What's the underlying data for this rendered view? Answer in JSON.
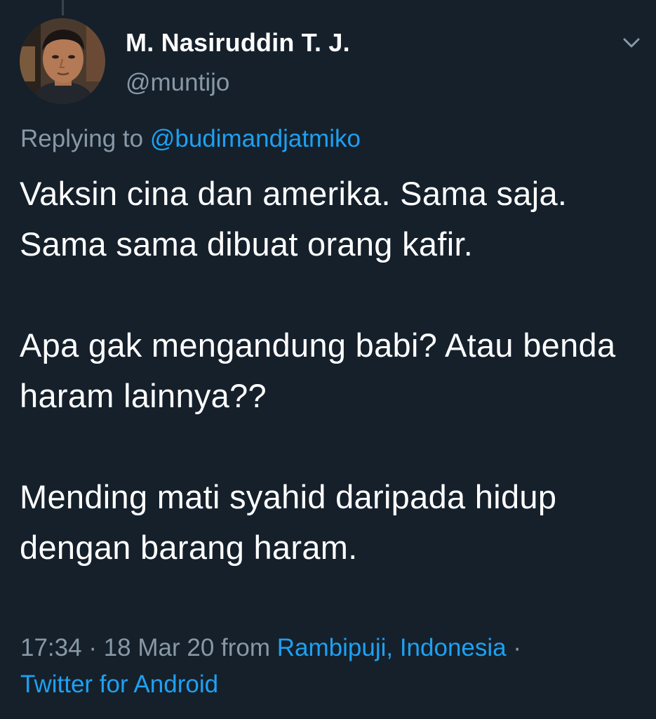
{
  "tweet": {
    "display_name": "M. Nasiruddin T. J.",
    "username": "@muntijo",
    "reply_prefix": "Replying to ",
    "reply_to": "@budimandjatmiko",
    "paragraphs": [
      "Vaksin cina dan amerika. Sama saja. Sama sama dibuat orang kafir.",
      "Apa gak mengandung babi? Atau benda haram lainnya??",
      "Mending mati syahid daripada hidup dengan barang haram."
    ],
    "time": "17:34",
    "separator": " · ",
    "date": "18 Mar 20",
    "from_label": " from ",
    "location": "Rambipuji, Indonesia",
    "client": "Twitter for Android"
  },
  "icons": {
    "menu": "chevron-down-icon",
    "avatar": "avatar"
  },
  "colors": {
    "background": "#15202b",
    "text": "#ffffff",
    "muted": "#8899a6",
    "link": "#1da1f2"
  }
}
